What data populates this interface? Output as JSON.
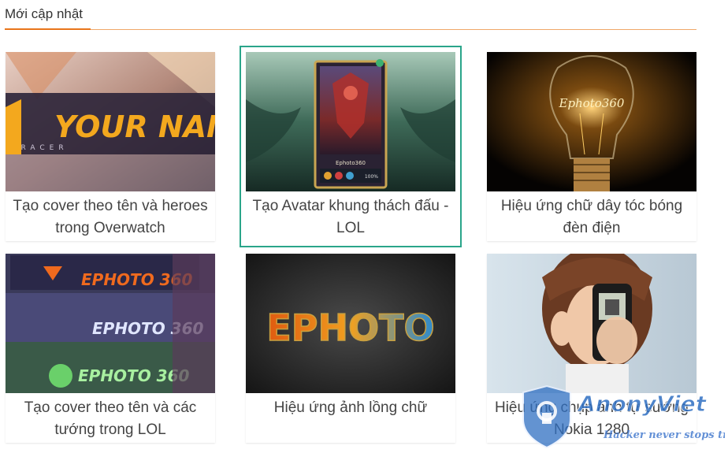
{
  "section": {
    "title": "Mới cập nhật"
  },
  "cards": [
    {
      "caption": "Tạo cover theo tên và heroes trong Overwatch",
      "thumb_text": "YOUR NAME",
      "thumb_sub": "TRACER"
    },
    {
      "caption": "Tạo Avatar khung thách đấu - LOL",
      "thumb_text": "Ephoto360",
      "thumb_sub": "100%"
    },
    {
      "caption": "Hiệu ứng chữ dây tóc bóng đèn điện",
      "thumb_text": "Ephoto360"
    },
    {
      "caption": "Tạo cover theo tên và các tướng trong LOL",
      "thumb_text": "EPHOTO 360"
    },
    {
      "caption": "Hiệu ứng ảnh lồng chữ",
      "thumb_text": "EPHOTO"
    },
    {
      "caption": "Hiệu ứng chụp ảnh tự sướng Nokia 1280"
    }
  ],
  "watermark": {
    "name": "AnonyViet",
    "slogan": "Hacker never stops trying"
  },
  "colors": {
    "accent": "#e8751a",
    "active_border": "#2aa58a",
    "caption": "#444444"
  }
}
